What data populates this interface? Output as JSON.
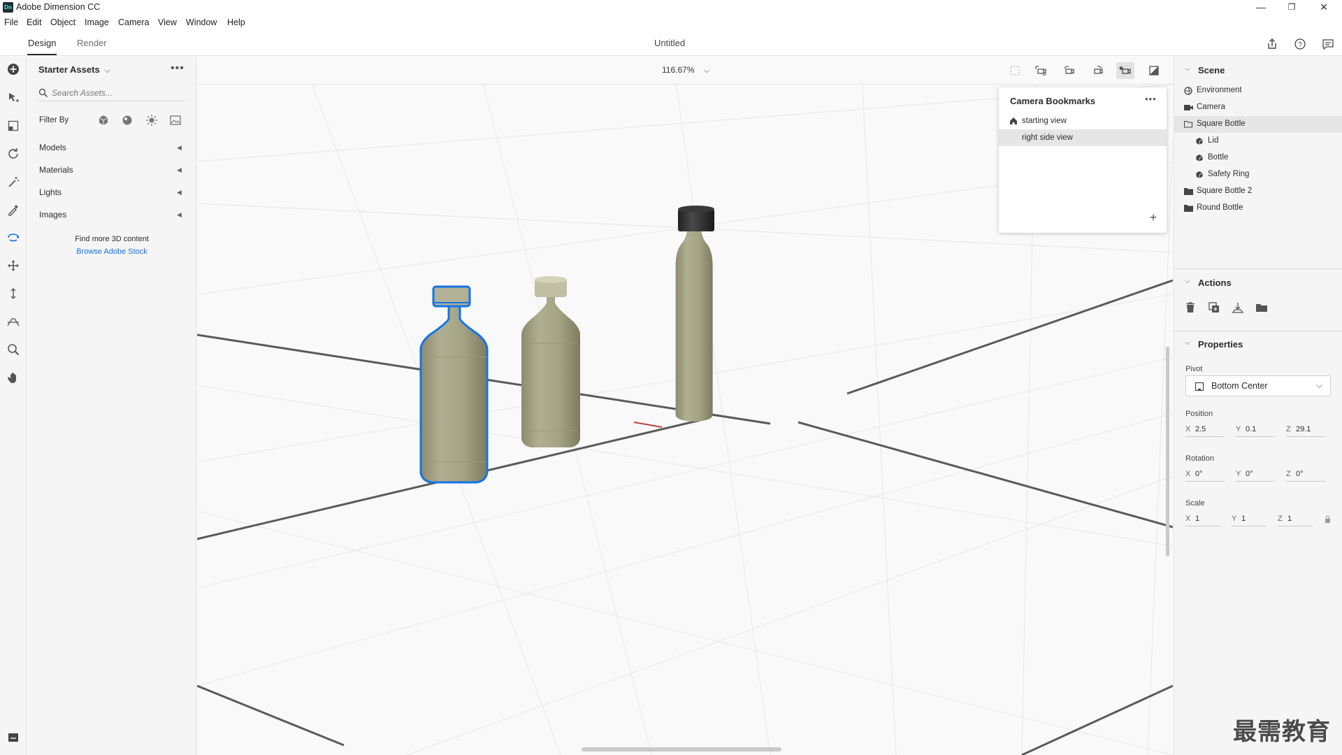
{
  "window": {
    "title": "Adobe Dimension CC",
    "app_badge": "Dn",
    "controls": {
      "minimize": "—",
      "maximize": "❐",
      "close": "✕"
    }
  },
  "menu": [
    "File",
    "Edit",
    "Object",
    "Image",
    "Camera",
    "View",
    "Window",
    "Help"
  ],
  "modes": {
    "design": "Design",
    "render": "Render",
    "active": "Design"
  },
  "document": {
    "title": "Untitled"
  },
  "assets": {
    "title": "Starter Assets",
    "search_placeholder": "Search Assets...",
    "filter_label": "Filter By",
    "sections": [
      "Models",
      "Materials",
      "Lights",
      "Images"
    ],
    "find_more": "Find more 3D content",
    "browse_link": "Browse Adobe Stock"
  },
  "viewport": {
    "zoom": "116.67%"
  },
  "bookmarks": {
    "title": "Camera Bookmarks",
    "items": [
      {
        "label": "starting view",
        "selected": false,
        "home": true
      },
      {
        "label": "right side view",
        "selected": true,
        "home": false
      }
    ]
  },
  "scene": {
    "title": "Scene",
    "items": [
      {
        "label": "Environment",
        "icon": "environment-icon",
        "indent": 0,
        "selected": false
      },
      {
        "label": "Camera",
        "icon": "camera-icon",
        "indent": 0,
        "selected": false
      },
      {
        "label": "Square Bottle",
        "icon": "folder-open-icon",
        "indent": 0,
        "selected": true
      },
      {
        "label": "Lid",
        "icon": "model-icon",
        "indent": 1,
        "selected": false
      },
      {
        "label": "Bottle",
        "icon": "model-icon",
        "indent": 1,
        "selected": false
      },
      {
        "label": "Safety Ring",
        "icon": "model-icon",
        "indent": 1,
        "selected": false
      },
      {
        "label": "Square Bottle 2",
        "icon": "folder-icon",
        "indent": 0,
        "selected": false
      },
      {
        "label": "Round Bottle",
        "icon": "folder-icon",
        "indent": 0,
        "selected": false
      }
    ]
  },
  "actions": {
    "title": "Actions"
  },
  "properties": {
    "title": "Properties",
    "pivot_label": "Pivot",
    "pivot_value": "Bottom Center",
    "position_label": "Position",
    "position": {
      "x": "2.5",
      "y": "0.1",
      "z": "29.1"
    },
    "rotation_label": "Rotation",
    "rotation": {
      "x": "0°",
      "y": "0°",
      "z": "0°"
    },
    "scale_label": "Scale",
    "scale": {
      "x": "1",
      "y": "1",
      "z": "1"
    }
  },
  "watermark": "最需教育",
  "colors": {
    "accent": "#1473e6",
    "selection": "#e6e6e6",
    "bottle": "#a3a283"
  }
}
